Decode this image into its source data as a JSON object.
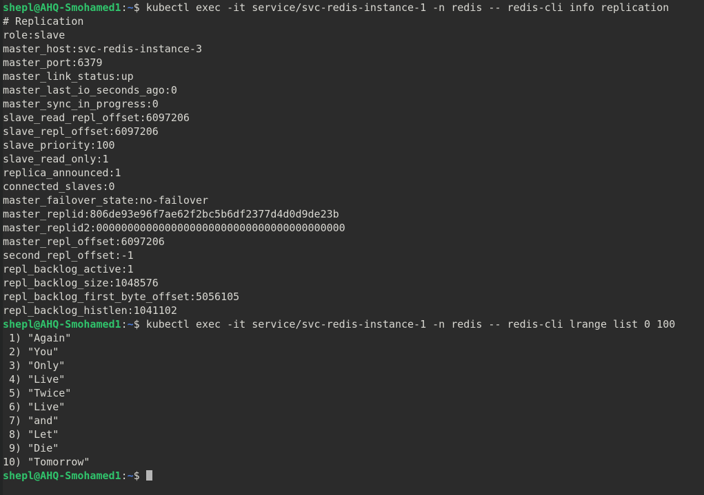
{
  "terminal": {
    "theme": {
      "background": "#2b2b2b",
      "gutter": "#232525",
      "foreground": "#d9d8d2",
      "prompt_user_color": "#30c46c",
      "prompt_path_color": "#4a7ad6",
      "cursor_color": "#b6b6b6"
    },
    "prompt": {
      "user_host": "shepl@AHQ-Smohamed1",
      "colon": ":",
      "path": "~",
      "sigil": "$"
    },
    "blocks": [
      {
        "type": "command",
        "command": " kubectl exec -it service/svc-redis-instance-1 -n redis -- redis-cli info replication"
      },
      {
        "type": "output",
        "lines": [
          "# Replication",
          "role:slave",
          "master_host:svc-redis-instance-3",
          "master_port:6379",
          "master_link_status:up",
          "master_last_io_seconds_ago:0",
          "master_sync_in_progress:0",
          "slave_read_repl_offset:6097206",
          "slave_repl_offset:6097206",
          "slave_priority:100",
          "slave_read_only:1",
          "replica_announced:1",
          "connected_slaves:0",
          "master_failover_state:no-failover",
          "master_replid:806de93e96f7ae62f2bc5b6df2377d4d0d9de23b",
          "master_replid2:0000000000000000000000000000000000000000",
          "master_repl_offset:6097206",
          "second_repl_offset:-1",
          "repl_backlog_active:1",
          "repl_backlog_size:1048576",
          "repl_backlog_first_byte_offset:5056105",
          "repl_backlog_histlen:1041102"
        ]
      },
      {
        "type": "command",
        "command": " kubectl exec -it service/svc-redis-instance-1 -n redis -- redis-cli lrange list 0 100"
      },
      {
        "type": "output",
        "lines": [
          " 1) \"Again\"",
          " 2) \"You\"",
          " 3) \"Only\"",
          " 4) \"Live\"",
          " 5) \"Twice\"",
          " 6) \"Live\"",
          " 7) \"and\"",
          " 8) \"Let\"",
          " 9) \"Die\"",
          "10) \"Tomorrow\""
        ]
      },
      {
        "type": "prompt_cursor"
      }
    ],
    "redis_info": {
      "role": "slave",
      "master_host": "svc-redis-instance-3",
      "master_port": "6379",
      "master_link_status": "up",
      "master_last_io_seconds_ago": "0",
      "master_sync_in_progress": "0",
      "slave_read_repl_offset": "6097206",
      "slave_repl_offset": "6097206",
      "slave_priority": "100",
      "slave_read_only": "1",
      "replica_announced": "1",
      "connected_slaves": "0",
      "master_failover_state": "no-failover",
      "master_replid": "806de93e96f7ae62f2bc5b6df2377d4d0d9de23b",
      "master_replid2": "0000000000000000000000000000000000000000",
      "master_repl_offset": "6097206",
      "second_repl_offset": "-1",
      "repl_backlog_active": "1",
      "repl_backlog_size": "1048576",
      "repl_backlog_first_byte_offset": "5056105",
      "repl_backlog_histlen": "1041102"
    },
    "redis_list": {
      "key": "list",
      "range": "0 100",
      "items": [
        "Again",
        "You",
        "Only",
        "Live",
        "Twice",
        "Live",
        "and",
        "Let",
        "Die",
        "Tomorrow"
      ]
    }
  }
}
